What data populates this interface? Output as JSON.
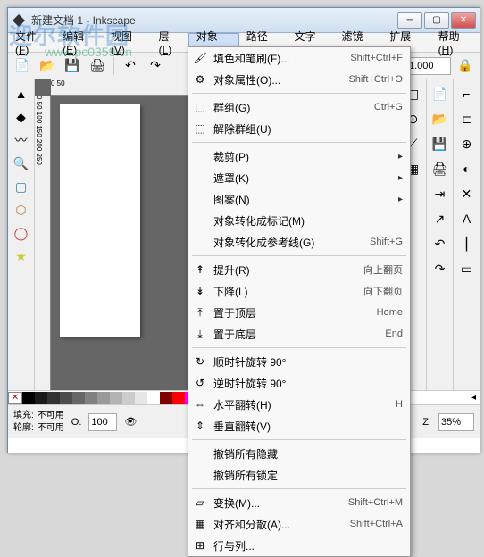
{
  "window": {
    "title": "新建文档 1 - Inkscape"
  },
  "menubar": {
    "items": [
      {
        "label": "文件",
        "u": "F"
      },
      {
        "label": "编辑",
        "u": "E"
      },
      {
        "label": "视图",
        "u": "V"
      },
      {
        "label": "层",
        "u": "L"
      },
      {
        "label": "对象",
        "u": "O"
      },
      {
        "label": "路径",
        "u": "P"
      },
      {
        "label": "文字",
        "u": "T"
      },
      {
        "label": "滤镜",
        "u": "S"
      },
      {
        "label": "扩展",
        "u": "N"
      },
      {
        "label": "帮助",
        "u": "H"
      }
    ]
  },
  "toolbar": {
    "value1": "1.000"
  },
  "menu": {
    "items": [
      {
        "icon": "🖌",
        "label": "填色和笔刷(F)...",
        "shortcut": "Shift+Ctrl+F"
      },
      {
        "icon": "⚙",
        "label": "对象属性(O)...",
        "shortcut": "Shift+Ctrl+O"
      },
      {
        "sep": true
      },
      {
        "icon": "⬚",
        "label": "群组(G)",
        "shortcut": "Ctrl+G"
      },
      {
        "icon": "⬚",
        "label": "解除群组(U)",
        "shortcut": ""
      },
      {
        "sep": true
      },
      {
        "label": "裁剪(P)",
        "arrow": true
      },
      {
        "label": "遮罩(K)",
        "arrow": true
      },
      {
        "label": "图案(N)",
        "arrow": true
      },
      {
        "label": "对象转化成标记(M)",
        "shortcut": ""
      },
      {
        "label": "对象转化成参考线(G)",
        "shortcut": "Shift+G"
      },
      {
        "sep": true
      },
      {
        "icon": "↟",
        "label": "提升(R)",
        "shortcut": "向上翻页"
      },
      {
        "icon": "↡",
        "label": "下降(L)",
        "shortcut": "向下翻页"
      },
      {
        "icon": "⤒",
        "label": "置于顶层",
        "shortcut": "Home"
      },
      {
        "icon": "⤓",
        "label": "置于底层",
        "shortcut": "End"
      },
      {
        "sep": true
      },
      {
        "icon": "↻",
        "label": "顺时针旋转 90°",
        "shortcut": ""
      },
      {
        "icon": "↺",
        "label": "逆时针旋转 90°",
        "shortcut": ""
      },
      {
        "icon": "⇔",
        "label": "水平翻转(H)",
        "shortcut": "H"
      },
      {
        "icon": "⇕",
        "label": "垂直翻转(V)",
        "shortcut": ""
      },
      {
        "sep": true
      },
      {
        "label": "撤销所有隐藏",
        "shortcut": ""
      },
      {
        "label": "撤销所有锁定",
        "shortcut": ""
      },
      {
        "sep": true
      },
      {
        "icon": "▱",
        "label": "变换(M)...",
        "shortcut": "Shift+Ctrl+M"
      },
      {
        "icon": "▦",
        "label": "对齐和分散(A)...",
        "shortcut": "Shift+Ctrl+A"
      },
      {
        "icon": "⊞",
        "label": "行与列...",
        "shortcut": ""
      }
    ]
  },
  "palette": {
    "colors": [
      "#000000",
      "#1a1a1a",
      "#333333",
      "#4d4d4d",
      "#666666",
      "#808080",
      "#999999",
      "#b3b3b3",
      "#cccccc",
      "#e6e6e6",
      "#ffffff",
      "#800000",
      "#ff0000",
      "#ff00ff",
      "#ff0080"
    ]
  },
  "status": {
    "fill_label": "填充:",
    "fill_value": "不可用",
    "stroke_label": "轮廓:",
    "stroke_value": "不可用",
    "o_label": "O:",
    "o_value": "100",
    "z_label": "Z:",
    "z_value": "35%"
  },
  "ruler_h_marks": "0        50",
  "ruler_v_marks": "0  50  100 150 200 250",
  "watermark": {
    "main": "迎尔软件园",
    "sub": "www.pc0359.cn"
  }
}
